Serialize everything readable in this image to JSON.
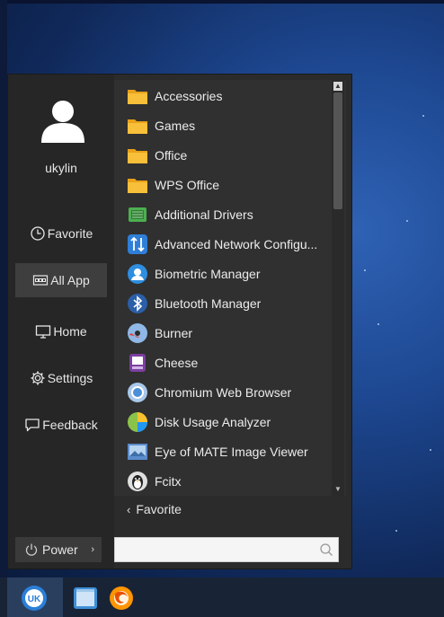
{
  "user": {
    "name": "ukylin"
  },
  "sidebar": {
    "items": [
      {
        "label": "Favorite",
        "icon": "clock-icon"
      },
      {
        "label": "All App",
        "icon": "all-apps-icon",
        "active": true
      },
      {
        "label": "Home",
        "icon": "monitor-icon"
      },
      {
        "label": "Settings",
        "icon": "gear-icon"
      },
      {
        "label": "Feedback",
        "icon": "feedback-icon"
      }
    ]
  },
  "apps": [
    {
      "label": "Accessories",
      "icon": "folder-icon"
    },
    {
      "label": "Games",
      "icon": "folder-icon"
    },
    {
      "label": "Office",
      "icon": "folder-icon"
    },
    {
      "label": "WPS Office",
      "icon": "folder-icon"
    },
    {
      "label": "Additional Drivers",
      "icon": "chip-icon"
    },
    {
      "label": "Advanced Network Configu...",
      "icon": "network-arrows-icon"
    },
    {
      "label": "Biometric Manager",
      "icon": "biometric-icon"
    },
    {
      "label": "Bluetooth Manager",
      "icon": "bluetooth-icon"
    },
    {
      "label": "Burner",
      "icon": "burner-disc-icon"
    },
    {
      "label": "Cheese",
      "icon": "cheese-icon"
    },
    {
      "label": "Chromium Web Browser",
      "icon": "chromium-icon"
    },
    {
      "label": "Disk Usage Analyzer",
      "icon": "pie-chart-icon"
    },
    {
      "label": "Eye of MATE Image Viewer",
      "icon": "image-viewer-icon"
    },
    {
      "label": "Fcitx",
      "icon": "penguin-icon"
    }
  ],
  "favorite_link": {
    "label": "Favorite"
  },
  "power": {
    "label": "Power"
  },
  "search": {
    "placeholder": "",
    "value": ""
  },
  "taskbar": {
    "items": [
      "start-menu-icon",
      "file-manager-icon",
      "firefox-icon"
    ],
    "start_label": "UK"
  }
}
